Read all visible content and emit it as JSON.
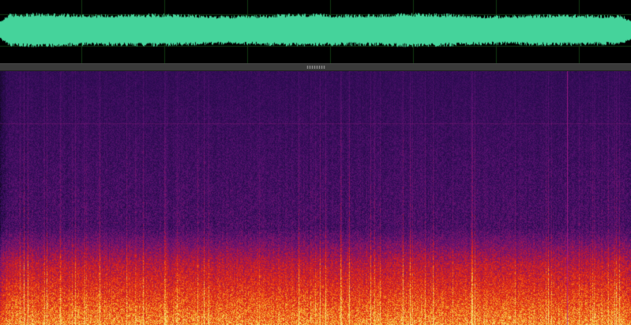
{
  "waveform": {
    "color": "#45d39b",
    "background": "#000000",
    "gridColor": "#123a12"
  },
  "divider": {
    "color": "#3a3a3a"
  },
  "spectrogram": {
    "colormap": "magma",
    "palette": [
      "#140826",
      "#2e0c55",
      "#5a1270",
      "#8a1565",
      "#c81a28",
      "#ea3a10",
      "#f4a028",
      "#f6dc7a"
    ],
    "markerColor": "#b01a8a"
  }
}
